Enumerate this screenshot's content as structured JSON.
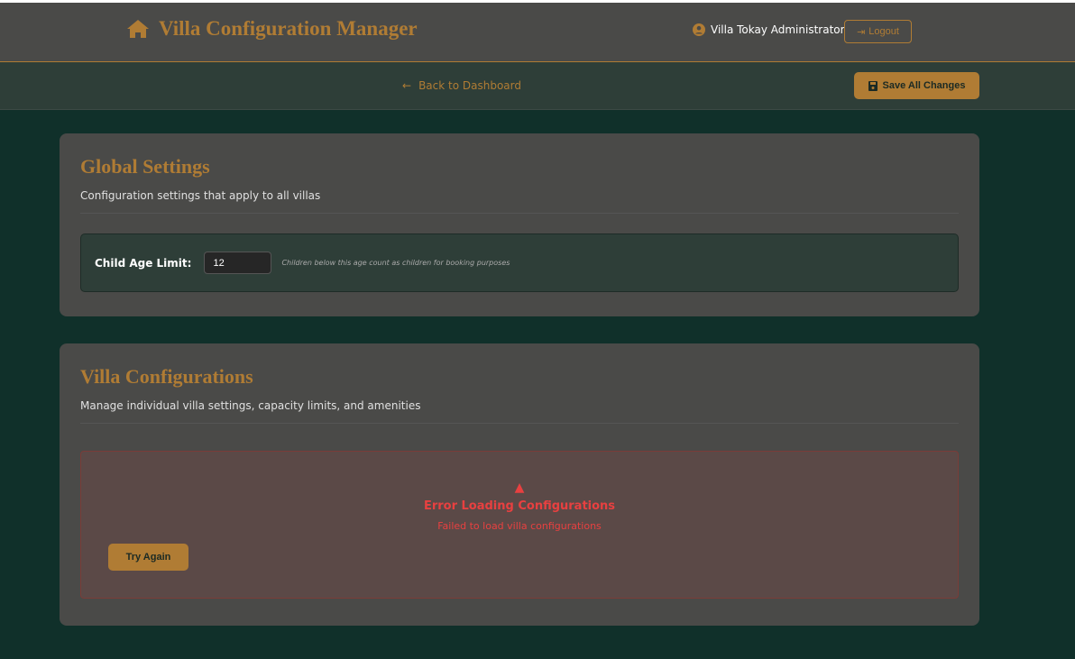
{
  "header": {
    "title": "Villa Configuration Manager",
    "user": "Villa Tokay Administrator",
    "logout": "Logout"
  },
  "subbar": {
    "back": "Back to Dashboard",
    "save": "Save All Changes"
  },
  "global": {
    "title": "Global Settings",
    "desc": "Configuration settings that apply to all villas",
    "child_age_label": "Child Age Limit:",
    "child_age_value": "12",
    "child_age_hint": "Children below this age count as children for booking purposes"
  },
  "villas": {
    "title": "Villa Configurations",
    "desc": "Manage individual villa settings, capacity limits, and amenities",
    "error_title": "Error Loading Configurations",
    "error_msg": "Failed to load villa configurations",
    "retry": "Try Again"
  }
}
